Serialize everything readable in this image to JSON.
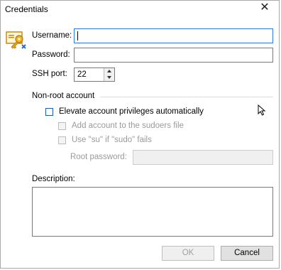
{
  "window": {
    "title": "Credentials",
    "close_glyph": "✕"
  },
  "form": {
    "username_label": "Username:",
    "username_value": "",
    "password_label": "Password:",
    "password_value": "",
    "ssh_port_label": "SSH port:",
    "ssh_port_value": "22"
  },
  "nonroot": {
    "group_title": "Non-root account",
    "elevate_label": "Elevate account privileges automatically",
    "elevate_checked": false,
    "sudoers_label": "Add account to the sudoers file",
    "su_label": "Use \"su\" if \"sudo\" fails",
    "root_password_label": "Root password:",
    "root_password_value": ""
  },
  "description": {
    "label": "Description:",
    "value": ""
  },
  "buttons": {
    "ok_label": "OK",
    "cancel_label": "Cancel"
  },
  "colors": {
    "focus_border": "#2f7bd6",
    "icon_key": "#e3a21a",
    "icon_accent": "#2a6fd0"
  },
  "icons": {
    "dialog_icon": "credentials-key-icon",
    "cursor": "mouse-pointer-icon"
  }
}
